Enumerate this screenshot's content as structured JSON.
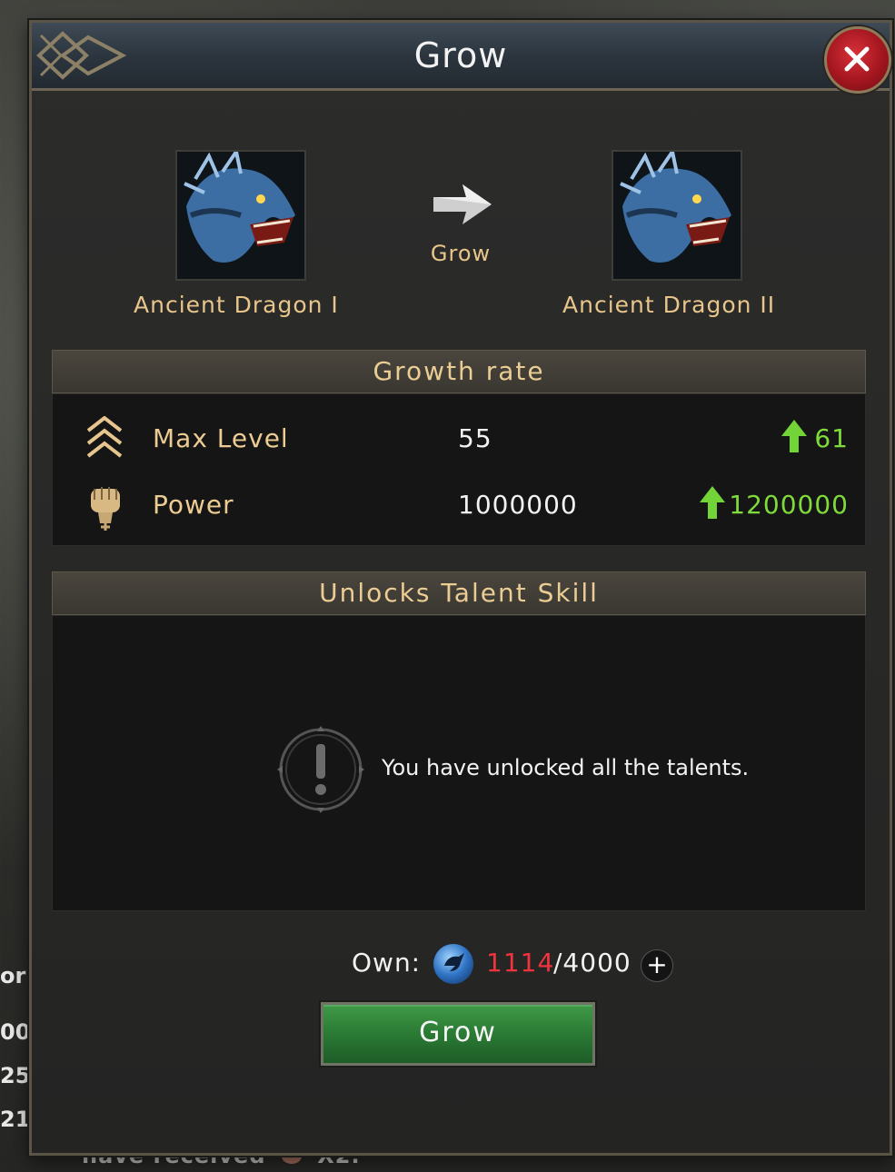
{
  "window": {
    "title": "Grow"
  },
  "evolution": {
    "from_name": "Ancient Dragon I",
    "to_name": "Ancient Dragon II",
    "arrow_label": "Grow"
  },
  "growth": {
    "header": "Growth rate",
    "rows": [
      {
        "label": "Max Level",
        "current": "55",
        "next": "61",
        "icon": "chevron-up-stack-icon"
      },
      {
        "label": "Power",
        "current": "1000000",
        "next": "1200000",
        "icon": "fist-icon"
      }
    ]
  },
  "talent": {
    "header": "Unlocks Talent Skill",
    "message": "You have unlocked all the talents."
  },
  "own": {
    "label": "Own:",
    "have": "1114",
    "need": "/4000",
    "plus": "+",
    "icon": "dragon-orb-icon"
  },
  "action": {
    "grow_button": "Grow"
  },
  "background": {
    "left_texts": [
      "or",
      "00",
      "25",
      "21"
    ],
    "bottom_text": "have received",
    "bottom_count": "X2."
  },
  "colors": {
    "accent_text": "#e8c58a",
    "increase": "#7fdb3a",
    "insufficient": "#f0333c",
    "button": "#2a7a34",
    "close": "#a3161f"
  }
}
